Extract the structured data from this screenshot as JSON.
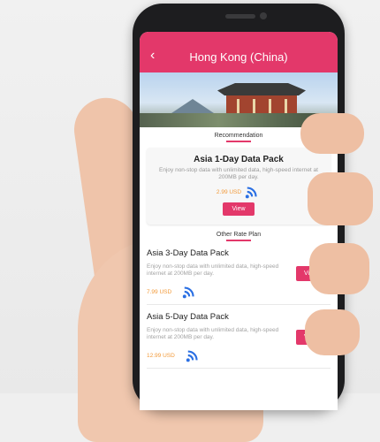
{
  "header": {
    "title": "Hong Kong (China)",
    "back_icon": "chevron-left-icon"
  },
  "recommendation": {
    "label": "Recommendation",
    "name": "Asia 1-Day Data Pack",
    "description": "Enjoy non-stop data with unlimited data, high-speed internet at 200MB per day.",
    "price": "2.99 USD",
    "view_label": "View"
  },
  "other": {
    "label": "Other Rate Plan"
  },
  "plans": [
    {
      "name": "Asia 3-Day Data Pack",
      "description": "Enjoy non-stop data with unlimited data, high-speed internet at 200MB per day.",
      "price": "7.99 USD",
      "view_label": "View"
    },
    {
      "name": "Asia 5-Day Data Pack",
      "description": "Enjoy non-stop data with unlimited data, high-speed internet at 200MB per day.",
      "price": "12.99 USD",
      "view_label": "View"
    }
  ],
  "colors": {
    "accent": "#e3386a",
    "price": "#f29a3a",
    "wifi": "#2a6fe3"
  }
}
